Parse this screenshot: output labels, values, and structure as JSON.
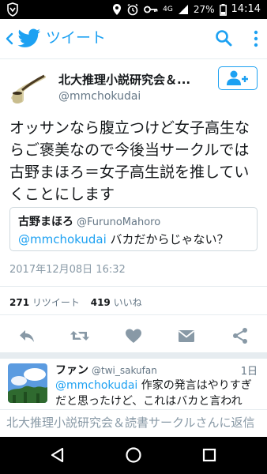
{
  "statusbar": {
    "signal": "4G",
    "battery": "27%",
    "time": "14:14"
  },
  "appbar": {
    "title": "ツイート",
    "back_icon": "chevron-left-icon",
    "logo_icon": "twitter-bird-icon",
    "search_icon": "search-icon",
    "menu_icon": "more-vertical-icon"
  },
  "tweet": {
    "author_name": "北大推理小説研究会＆...",
    "author_handle": "@mmchokudai",
    "text": "オッサンなら腹立つけど女子高生ならご褒美なので今後当サークルでは古野まほろ＝女子高生説を推していくことにします",
    "quote": {
      "name": "古野まほろ",
      "handle": "@FurunoMahoro",
      "mention": "@mmchokudai",
      "text": " バカだからじゃない？"
    },
    "timestamp": "2017年12月08日 16:32",
    "retweets": "271",
    "retweets_label": "リツイート",
    "likes": "419",
    "likes_label": "いいね"
  },
  "reply": {
    "name": "ファン",
    "handle": "@twi_sakufan",
    "time": "1日",
    "mention": "@mmchokudai",
    "text_line1": " 作家の発言はやりすぎ",
    "text_line2": "だと思ったけど、これはバカと言われ"
  },
  "composer": {
    "placeholder": "北大推理小説研究会＆読書サークルさんに返信"
  },
  "colors": {
    "accent": "#1da1f2",
    "text": "#14171a",
    "muted": "#657786"
  }
}
